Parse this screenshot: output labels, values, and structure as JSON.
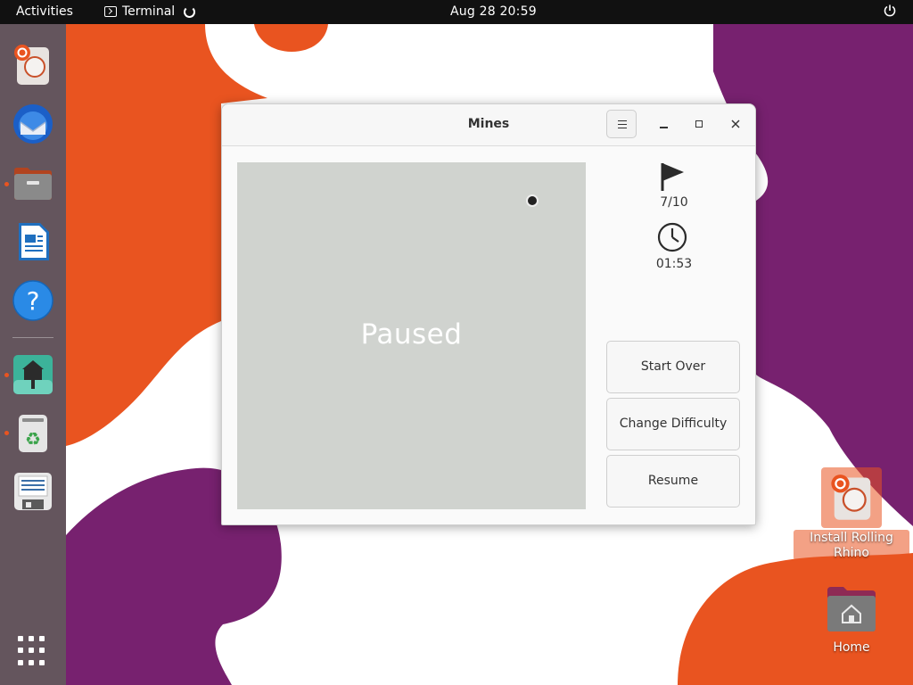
{
  "topbar": {
    "activities": "Activities",
    "app_name": "Terminal",
    "clock": "Aug 28  20:59"
  },
  "dock": {
    "items": [
      {
        "name": "installer"
      },
      {
        "name": "thunderbird"
      },
      {
        "name": "files"
      },
      {
        "name": "writer"
      },
      {
        "name": "help"
      },
      {
        "name": "mines-app"
      },
      {
        "name": "trash"
      },
      {
        "name": "floppy"
      }
    ]
  },
  "window": {
    "title": "Mines",
    "board": {
      "status_text": "Paused"
    },
    "flags": "7/10",
    "time": "01:53",
    "buttons": {
      "start_over": "Start Over",
      "change_difficulty": "Change Difficulty",
      "resume": "Resume"
    }
  },
  "desktop": {
    "icons": [
      {
        "label_line1": "Install Rolling",
        "label_line2": "Rhino"
      },
      {
        "label": "Home"
      }
    ]
  },
  "colors": {
    "ubuntu_orange": "#e95420",
    "aubergine": "#77216f",
    "board_gray": "#d0d3cf"
  }
}
